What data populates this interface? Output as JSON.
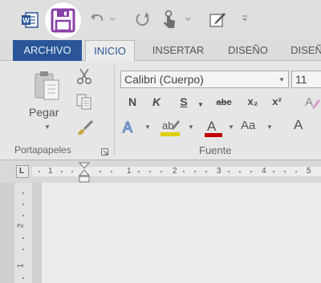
{
  "tabs": {
    "archivo": "ARCHIVO",
    "inicio": "INICIO",
    "insertar": "INSERTAR",
    "diseno": "DISEÑO",
    "diseno_cut": "DISEÑ"
  },
  "clipboard": {
    "paste_label": "Pegar",
    "group_label": "Portapapeles"
  },
  "font": {
    "name": "Calibri (Cuerpo)",
    "size": "11",
    "group_label": "Fuente",
    "bold": "N",
    "italic": "K",
    "underline": "S",
    "strikethrough": "abc",
    "subscript": "x₂",
    "superscript": "x²",
    "change_case": "Aa",
    "grow_font": "A"
  },
  "ruler": {
    "horizontal": [
      "1",
      "1",
      "2",
      "3",
      "4",
      "5"
    ],
    "vertical": [
      "2",
      "1"
    ]
  },
  "colors": {
    "file_tab": "#2a5699",
    "save_icon": "#8a3fa8",
    "font_color_bar": "#c00000",
    "highlight_bar": "#e0d000"
  },
  "icons": {
    "app": "word-icon",
    "save": "save-icon",
    "undo": "undo-icon",
    "redo": "redo-icon",
    "touch": "touch-mode-icon",
    "edit": "edit-icon",
    "paste": "paste-icon",
    "cut": "scissors-icon",
    "copy": "copy-icon",
    "format_painter": "brush-icon"
  }
}
